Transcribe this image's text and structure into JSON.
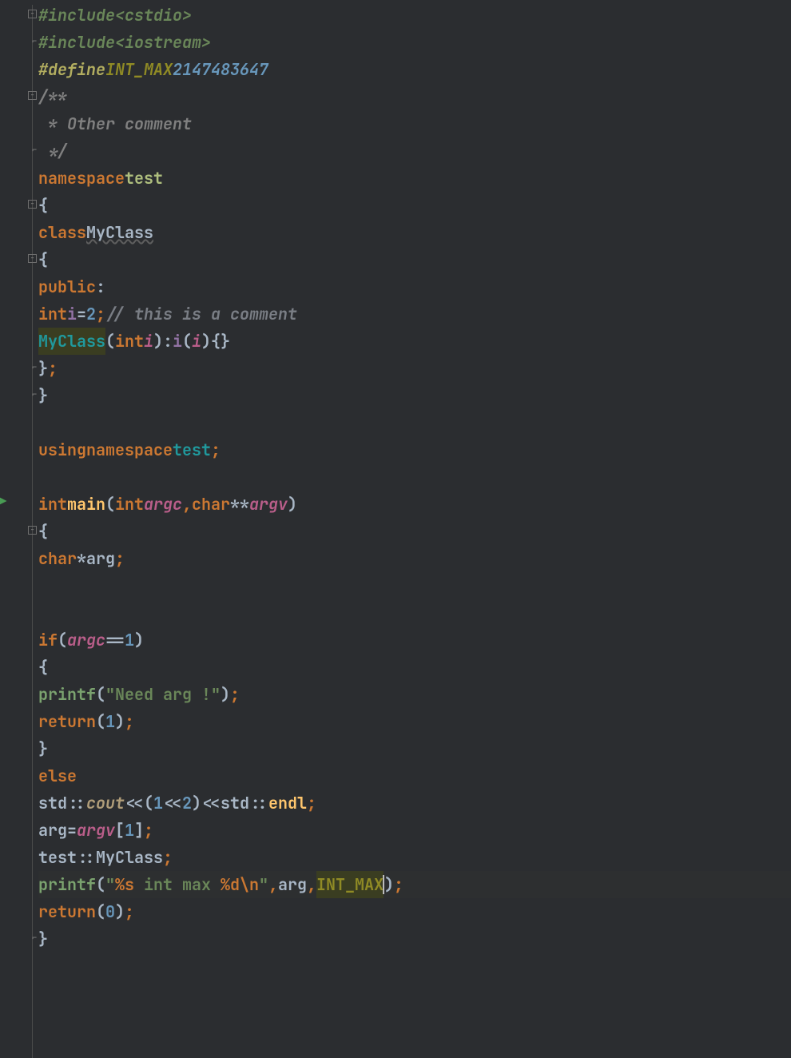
{
  "code": {
    "l1": {
      "include": "#include",
      "path": "<cstdio>"
    },
    "l2": {
      "include": "#include",
      "path": "<iostream>"
    },
    "l3": {
      "define": "#define",
      "name": "INT_MAX",
      "value": "2147483647"
    },
    "l4": "/**",
    "l5": " * Other comment",
    "l6": " */",
    "l7": {
      "kw": "namespace",
      "name": "test"
    },
    "l8": "{",
    "l9": {
      "kw": "class",
      "name": "MyClass"
    },
    "l10": "{",
    "l11": {
      "kw": "public",
      "colon": ":"
    },
    "l12": {
      "type": "int",
      "ident": "i",
      "eq": "=",
      "num": "2",
      "semi": ";",
      "comment": "// this is a comment"
    },
    "l13": {
      "ctor": "MyClass",
      "open": "(",
      "ptype": "int",
      "param": "i",
      "close": ")",
      "colon": ":",
      "member": "i",
      "open2": "(",
      "param2": "i",
      "close2": ")",
      "braces": "{}"
    },
    "l14": {
      "close": "}",
      "semi": ";"
    },
    "l15": "}",
    "l17": {
      "kw1": "using",
      "kw2": "namespace",
      "name": "test",
      "semi": ";"
    },
    "l19": {
      "type": "int",
      "fn": "main",
      "open": "(",
      "ptype1": "int",
      "param1": "argc",
      "comma": ",",
      "ptype2": "char",
      "stars": "**",
      "param2": "argv",
      "close": ")"
    },
    "l20": "{",
    "l21": {
      "type": "char",
      "star": "*",
      "ident": "arg",
      "semi": ";"
    },
    "l24": {
      "kw": "if",
      "open": "(",
      "param": "argc",
      "op": "==",
      "num": "1",
      "close": ")"
    },
    "l25": "{",
    "l26": {
      "fn": "printf",
      "open": "(",
      "str": "\"Need arg !\"",
      "close": ")",
      "semi": ";"
    },
    "l27": {
      "kw": "return",
      "open": "(",
      "num": "1",
      "close": ")",
      "semi": ";"
    },
    "l28": "}",
    "l29": {
      "kw": "else"
    },
    "l30": {
      "ns": "std",
      "dcolon": "::",
      "cout": "cout",
      "lsh1": "<<",
      "open": "(",
      "n1": "1",
      "lsh2": "<<",
      "n2": "2",
      "close": ")",
      "lsh3": "<<",
      "ns2": "std",
      "dcolon2": "::",
      "endl": "endl",
      "semi": ";"
    },
    "l31": {
      "lhs": "arg",
      "eq": "=",
      "param": "argv",
      "open": "[",
      "num": "1",
      "close": "]",
      "semi": ";"
    },
    "l32": {
      "ns": "test",
      "dcolon": "::",
      "cls": "MyClass",
      "semi": ";"
    },
    "l33": {
      "fn": "printf",
      "open": "(",
      "q1": "\"",
      "f1": "%s",
      "mid": " int max ",
      "f2": "%d",
      "esc": "\\n",
      "q2": "\"",
      "comma1": ",",
      "arg1": "arg",
      "comma2": ",",
      "macro": "INT_MAX",
      "close": ")",
      "semi": ";"
    },
    "l34": {
      "kw": "return",
      "open": "(",
      "num": "0",
      "close": ")",
      "semi": ";"
    },
    "l35": "}"
  }
}
